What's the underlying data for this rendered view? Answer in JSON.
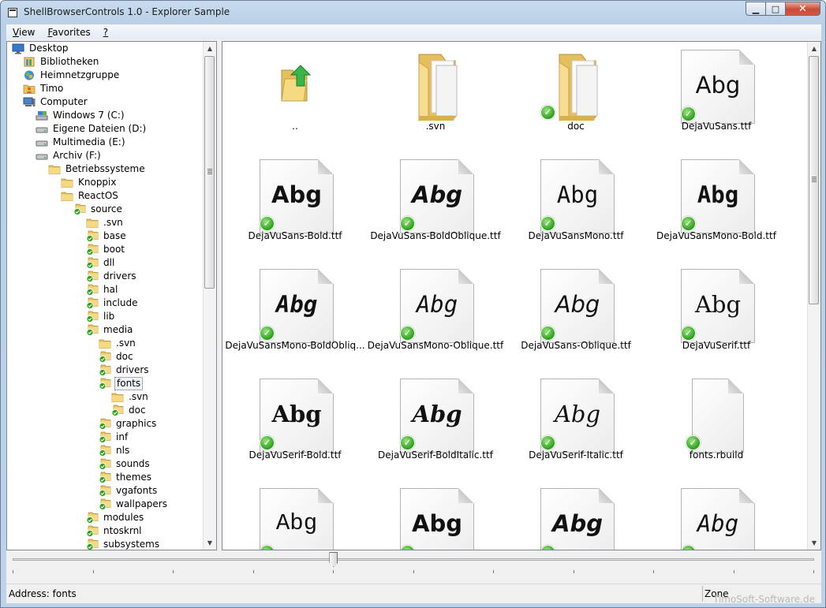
{
  "window": {
    "title": "ShellBrowserControls 1.0 - Explorer Sample",
    "minimize": "▁",
    "maximize": "□",
    "close": "✕"
  },
  "menu": [
    {
      "label": "View",
      "mnemonic": "V",
      "rest": "iew"
    },
    {
      "label": "Favorites",
      "mnemonic": "F",
      "rest": "avorites"
    },
    {
      "label": "?",
      "mnemonic": "?",
      "rest": ""
    }
  ],
  "tree": {
    "selected": "fonts",
    "items": [
      {
        "label": "Desktop",
        "level": 0,
        "icon": "desktop-icon"
      },
      {
        "label": "Bibliotheken",
        "level": 1,
        "icon": "library-icon"
      },
      {
        "label": "Heimnetzgruppe",
        "level": 1,
        "icon": "homegroup-icon"
      },
      {
        "label": "Timo",
        "level": 1,
        "icon": "user-folder-icon"
      },
      {
        "label": "Computer",
        "level": 1,
        "icon": "computer-icon"
      },
      {
        "label": "Windows 7 (C:)",
        "level": 2,
        "icon": "system-drive-icon"
      },
      {
        "label": "Eigene Dateien (D:)",
        "level": 2,
        "icon": "drive-icon"
      },
      {
        "label": "Multimedia (E:)",
        "level": 2,
        "icon": "drive-icon"
      },
      {
        "label": "Archiv (F:)",
        "level": 2,
        "icon": "drive-icon"
      },
      {
        "label": "Betriebssysteme",
        "level": 3,
        "icon": "folder-icon"
      },
      {
        "label": "Knoppix",
        "level": 4,
        "icon": "folder-icon"
      },
      {
        "label": "ReactOS",
        "level": 4,
        "icon": "folder-icon"
      },
      {
        "label": "source",
        "level": 5,
        "icon": "folder-check-icon"
      },
      {
        "label": ".svn",
        "level": 6,
        "icon": "folder-icon"
      },
      {
        "label": "base",
        "level": 6,
        "icon": "folder-check-icon"
      },
      {
        "label": "boot",
        "level": 6,
        "icon": "folder-check-icon"
      },
      {
        "label": "dll",
        "level": 6,
        "icon": "folder-check-icon"
      },
      {
        "label": "drivers",
        "level": 6,
        "icon": "folder-check-icon"
      },
      {
        "label": "hal",
        "level": 6,
        "icon": "folder-check-icon"
      },
      {
        "label": "include",
        "level": 6,
        "icon": "folder-check-icon"
      },
      {
        "label": "lib",
        "level": 6,
        "icon": "folder-check-icon"
      },
      {
        "label": "media",
        "level": 6,
        "icon": "folder-check-icon"
      },
      {
        "label": ".svn",
        "level": 7,
        "icon": "folder-icon"
      },
      {
        "label": "doc",
        "level": 7,
        "icon": "folder-check-icon"
      },
      {
        "label": "drivers",
        "level": 7,
        "icon": "folder-check-icon"
      },
      {
        "label": "fonts",
        "level": 7,
        "icon": "folder-check-icon"
      },
      {
        "label": ".svn",
        "level": 8,
        "icon": "folder-icon"
      },
      {
        "label": "doc",
        "level": 8,
        "icon": "folder-check-icon"
      },
      {
        "label": "graphics",
        "level": 7,
        "icon": "folder-check-icon"
      },
      {
        "label": "inf",
        "level": 7,
        "icon": "folder-check-icon"
      },
      {
        "label": "nls",
        "level": 7,
        "icon": "folder-check-icon"
      },
      {
        "label": "sounds",
        "level": 7,
        "icon": "folder-check-icon"
      },
      {
        "label": "themes",
        "level": 7,
        "icon": "folder-check-icon"
      },
      {
        "label": "vgafonts",
        "level": 7,
        "icon": "folder-check-icon"
      },
      {
        "label": "wallpapers",
        "level": 7,
        "icon": "folder-check-icon"
      },
      {
        "label": "modules",
        "level": 6,
        "icon": "folder-check-icon"
      },
      {
        "label": "ntoskrnl",
        "level": 6,
        "icon": "folder-check-icon"
      },
      {
        "label": "subsystems",
        "level": 6,
        "icon": "folder-check-icon"
      }
    ]
  },
  "files": [
    {
      "name": "..",
      "kind": "up",
      "preview": "",
      "style": "",
      "check": false
    },
    {
      "name": ".svn",
      "kind": "folder",
      "preview": "",
      "style": "",
      "check": false
    },
    {
      "name": "doc",
      "kind": "folder",
      "preview": "",
      "style": "",
      "check": true
    },
    {
      "name": "DejaVuSans.ttf",
      "kind": "font",
      "preview": "Abg",
      "style": "sans",
      "check": true
    },
    {
      "name": "DejaVuSans-Bold.ttf",
      "kind": "font",
      "preview": "Abg",
      "style": "sans-bold",
      "check": true
    },
    {
      "name": "DejaVuSans-BoldOblique.ttf",
      "kind": "font",
      "preview": "Abg",
      "style": "sans-bold-oblique",
      "check": true
    },
    {
      "name": "DejaVuSansMono.ttf",
      "kind": "font",
      "preview": "Abg",
      "style": "mono",
      "check": true
    },
    {
      "name": "DejaVuSansMono-Bold.ttf",
      "kind": "font",
      "preview": "Abg",
      "style": "mono-bold",
      "check": true
    },
    {
      "name": "DejaVuSansMono-BoldObliq...",
      "kind": "font",
      "preview": "Abg",
      "style": "mono-bold-oblique",
      "check": true
    },
    {
      "name": "DejaVuSansMono-Oblique.ttf",
      "kind": "font",
      "preview": "Abg",
      "style": "mono-oblique",
      "check": true
    },
    {
      "name": "DejaVuSans-Oblique.ttf",
      "kind": "font",
      "preview": "Abg",
      "style": "sans-oblique",
      "check": true
    },
    {
      "name": "DejaVuSerif.ttf",
      "kind": "font",
      "preview": "Abg",
      "style": "serif",
      "check": true
    },
    {
      "name": "DejaVuSerif-Bold.ttf",
      "kind": "font",
      "preview": "Abg",
      "style": "serif-bold",
      "check": true
    },
    {
      "name": "DejaVuSerif-BoldItalic.ttf",
      "kind": "font",
      "preview": "Abg",
      "style": "serif-bold-italic",
      "check": true
    },
    {
      "name": "DejaVuSerif-Italic.ttf",
      "kind": "font",
      "preview": "Abg",
      "style": "serif-italic",
      "check": true
    },
    {
      "name": "fonts.rbuild",
      "kind": "blank",
      "preview": "",
      "style": "",
      "check": true
    },
    {
      "name": "",
      "kind": "font",
      "preview": "Abg",
      "style": "mono-light",
      "check": true
    },
    {
      "name": "",
      "kind": "font",
      "preview": "Abg",
      "style": "sans-bold",
      "check": true
    },
    {
      "name": "",
      "kind": "font",
      "preview": "Abg",
      "style": "sans-bold-oblique",
      "check": true
    },
    {
      "name": "",
      "kind": "font",
      "preview": "Abg",
      "style": "mono-oblique",
      "check": true
    }
  ],
  "slider": {
    "value_fraction": 0.4
  },
  "status": {
    "address": "Address: fonts",
    "zone": "Zone",
    "watermark": "TimoSoft-Software.de"
  },
  "colors": {
    "check_green": "#2aa01a",
    "folder_yellow": "#f2d27a",
    "up_arrow_green": "#39b54a"
  }
}
